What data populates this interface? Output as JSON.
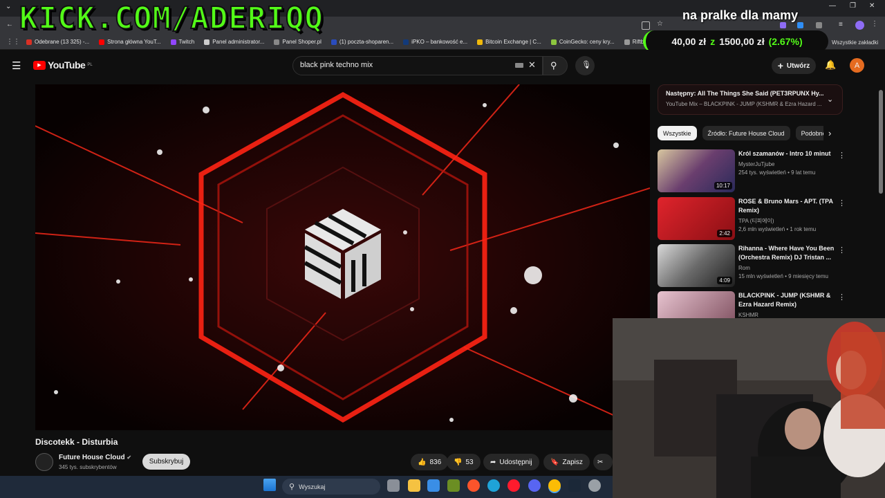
{
  "overlay": {
    "kick_text": "KICK.COM/ADERIQQ",
    "goal_title": "na pralke dla mamy",
    "donation_current": "40,00 zł",
    "donation_sep": "z",
    "donation_target": "1500,00 zł",
    "donation_percent": "(2.67%)",
    "donation_progress": 0.0267
  },
  "bookmarks": [
    {
      "label": "Odebrane (13 325) -...",
      "color": "#d93025"
    },
    {
      "label": "Strona główna YouT...",
      "color": "#ff0000"
    },
    {
      "label": "Twitch",
      "color": "#9146ff"
    },
    {
      "label": "Panel administrator...",
      "color": "#cccccc"
    },
    {
      "label": "Panel Shoper.pl",
      "color": "#888888"
    },
    {
      "label": "(1) poczta-shoparen...",
      "color": "#2a4cbd"
    },
    {
      "label": "iPKO – bankowość e...",
      "color": "#123a7a"
    },
    {
      "label": "Bitcoin Exchange | C...",
      "color": "#f0b90b"
    },
    {
      "label": "CoinGecko: ceny kry...",
      "color": "#8dc63f"
    },
    {
      "label": "Riftbound - League...",
      "color": "#999999"
    }
  ],
  "bookmarks_all": "Wszystkie zakładki",
  "youtube": {
    "logo": "YouTube",
    "region": "PL",
    "search_value": "black pink techno mix",
    "create_label": "Utwórz",
    "avatar_letter": "A"
  },
  "video": {
    "title": "Discotekk - Disturbia",
    "channel": "Future House Cloud",
    "subscribers": "345 tys. subskrybentów",
    "subscribe_label": "Subskrybuj",
    "likes": "836",
    "dislikes": "53",
    "share_label": "Udostępnij",
    "save_label": "Zapisz"
  },
  "upnext": {
    "title": "Następny: All The Things She Said (PET3RPUNX Hy...",
    "subtitle": "YouTube Mix – BLACKPINK - JUMP (KSHMR & Ezra Hazard ..."
  },
  "chips": [
    "Wszystkie",
    "Źródło: Future House Cloud",
    "Podobne"
  ],
  "recommendations": [
    {
      "title": "Król szamanów - Intro 10 minut",
      "channel": "MysterJuTjube",
      "meta": "254 tys. wyświetleń • 9 lat temu",
      "duration": "10:17",
      "bg": "#7a5a3a"
    },
    {
      "title": "ROSE & Bruno Mars - APT. (TPA Remix)",
      "channel": "TPA (티피에이)",
      "meta": "2,6 mln wyświetleń • 1 rok temu",
      "duration": "2:42",
      "bg": "#c8222a"
    },
    {
      "title": "Rihanna - Where Have You Been (Orchestra Remix) DJ Tristan ...",
      "channel": "Rom",
      "meta": "15 mln wyświetleń • 9 miesięcy temu",
      "duration": "4:09",
      "bg": "#9a9a9a"
    },
    {
      "title": "BLACKPINK - JUMP (KSHMR & Ezra Hazard Remix)",
      "channel": "KSHMR",
      "meta": "",
      "duration": "",
      "bg": "#c9a4b0"
    }
  ],
  "taskbar": {
    "search_placeholder": "Wyszukaj"
  }
}
